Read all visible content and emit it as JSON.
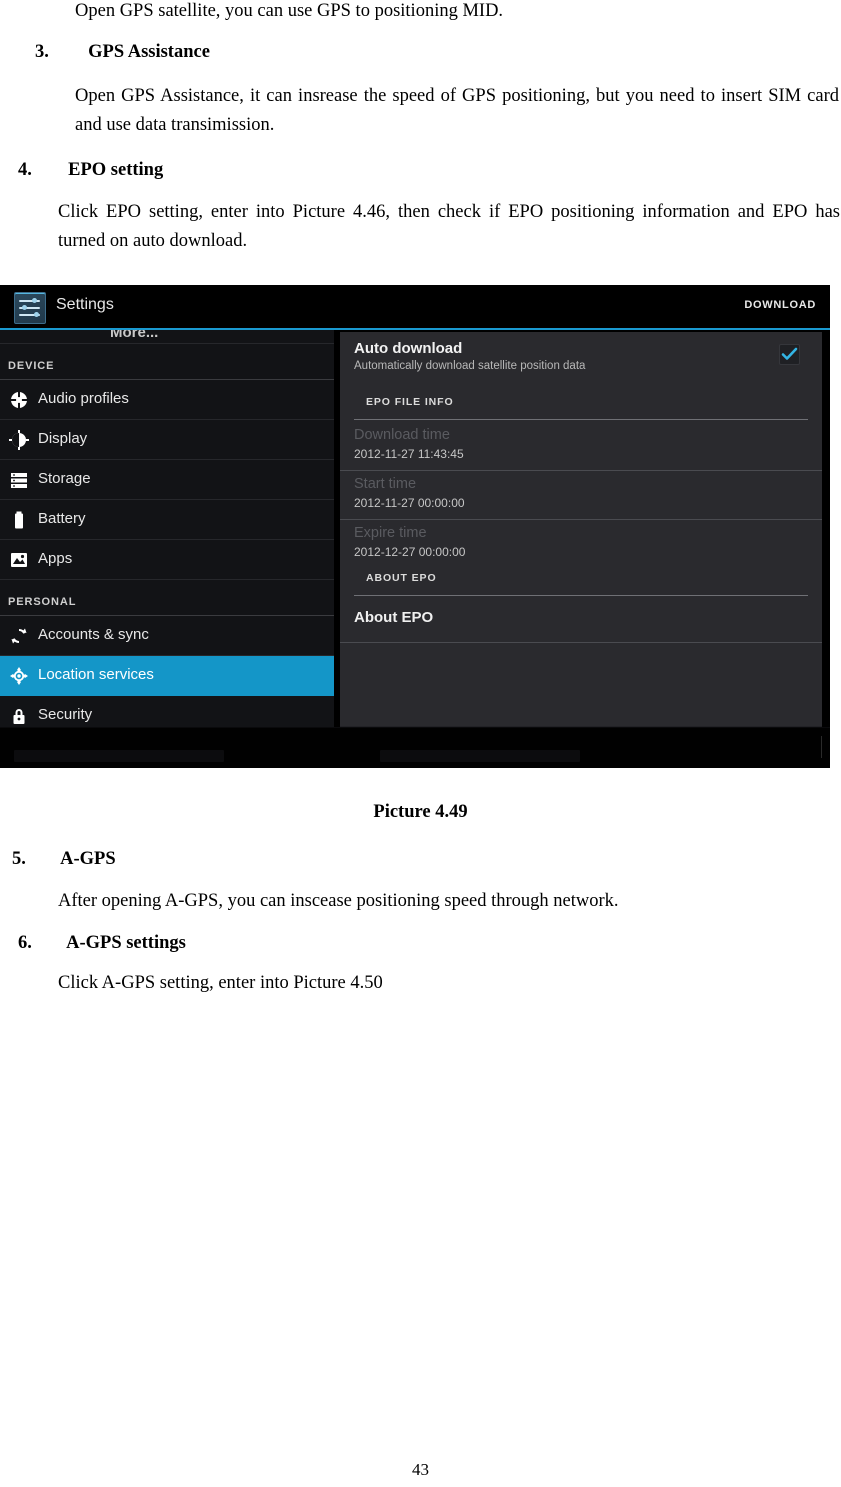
{
  "document": {
    "line_top": "Open GPS satellite, you can use GPS to positioning MID.",
    "item3": {
      "num": "3.",
      "title": "GPS Assistance",
      "body": "Open GPS Assistance, it can insrease the speed of GPS positioning, but you need to insert SIM card and use data transimission."
    },
    "item4": {
      "num": "4.",
      "title": "EPO setting",
      "body": "Click EPO setting, enter into Picture 4.46, then check if EPO positioning information and EPO has turned on auto download."
    },
    "caption": "Picture 4.49",
    "item5": {
      "num": "5.",
      "title": "A-GPS",
      "body": "After opening A-GPS, you can inscease positioning speed through network."
    },
    "item6": {
      "num": "6.",
      "title": "A-GPS settings",
      "body": "Click A-GPS setting, enter into Picture 4.50"
    },
    "page_number": "43"
  },
  "screenshot": {
    "action_bar": {
      "app_icon": "settings-sliders-icon",
      "title": "Settings",
      "action_label": "DOWNLOAD"
    },
    "sidebar": {
      "clipped_top_item": "More...",
      "sections": [
        {
          "header": "DEVICE",
          "items": [
            {
              "label": "Audio profiles",
              "icon": "audio-profiles-icon",
              "selected": false
            },
            {
              "label": "Display",
              "icon": "display-brightness-icon",
              "selected": false
            },
            {
              "label": "Storage",
              "icon": "storage-icon",
              "selected": false
            },
            {
              "label": "Battery",
              "icon": "battery-icon",
              "selected": false
            },
            {
              "label": "Apps",
              "icon": "apps-icon",
              "selected": false
            }
          ]
        },
        {
          "header": "PERSONAL",
          "items": [
            {
              "label": "Accounts & sync",
              "icon": "sync-icon",
              "selected": false
            },
            {
              "label": "Location services",
              "icon": "location-target-icon",
              "selected": true
            },
            {
              "label": "Security",
              "icon": "lock-icon",
              "selected": false
            }
          ]
        }
      ]
    },
    "detail": {
      "auto_download": {
        "title": "Auto download",
        "summary": "Automatically download satellite position data",
        "checked": true
      },
      "section_file_info": "EPO FILE INFO",
      "file_info": [
        {
          "key": "Download time",
          "value": "2012-11-27 11:43:45"
        },
        {
          "key": "Start time",
          "value": "2012-11-27 00:00:00"
        },
        {
          "key": "Expire time",
          "value": "2012-12-27 00:00:00"
        }
      ],
      "section_about": "ABOUT EPO",
      "about_item": "About EPO"
    },
    "colors": {
      "accent": "#1496c8",
      "action_bar_underline": "#1a9ad0",
      "sidebar_bg": "#121316",
      "detail_bg": "#2a2a2e",
      "checkmark": "#33b5e5"
    }
  }
}
